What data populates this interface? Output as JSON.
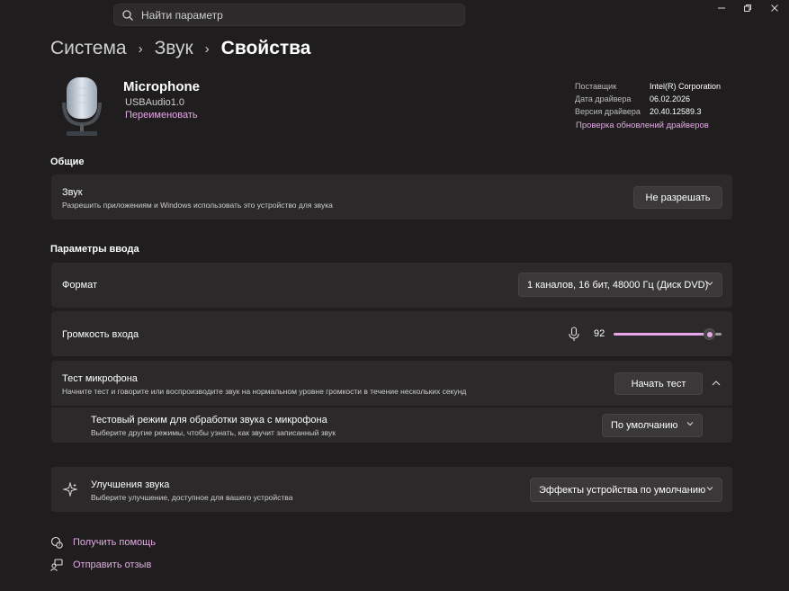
{
  "search": {
    "placeholder": "Найти параметр"
  },
  "breadcrumb": {
    "item1": "Система",
    "item2": "Звук",
    "current": "Свойства"
  },
  "device": {
    "name": "Microphone",
    "subname": "USBAudio1.0",
    "rename": "Переименовать",
    "info": [
      {
        "key": "Поставщик",
        "value": "Intel(R) Corporation"
      },
      {
        "key": "Дата драйвера",
        "value": "06.02.2026"
      },
      {
        "key": "Версия драйвера",
        "value": "20.40.12589.3"
      }
    ],
    "update_link": "Проверка обновлений драйверов"
  },
  "general": {
    "title": "Общие",
    "sound_title": "Звук",
    "sound_desc": "Разрешить приложениям и Windows использовать это устройство для звука",
    "deny_button": "Не разрешать"
  },
  "input": {
    "title": "Параметры ввода",
    "format_label": "Формат",
    "format_value": "1 каналов, 16 бит, 48000 Гц (Диск DVD)",
    "volume_label": "Громкость входа",
    "volume_value": "92",
    "volume_level": 0.92,
    "test_title": "Тест микрофона",
    "test_desc": "Начните тест и говорите или воспроизводите звук на нормальном уровне громкости в течение нескольких секунд",
    "test_button": "Начать тест",
    "mode_title": "Тестовый режим для обработки звука с микрофона",
    "mode_desc": "Выберите другие режимы, чтобы узнать, как звучит записанный звук",
    "mode_value": "По умолчанию"
  },
  "enhance": {
    "title": "Улучшения звука",
    "desc": "Выберите улучшение, доступное для вашего устройства",
    "value": "Эффекты устройства по умолчанию"
  },
  "footer": {
    "help": "Получить помощь",
    "feedback": "Отправить отзыв"
  },
  "colors": {
    "accent": "#e6a8e8",
    "background": "#1f1d1d",
    "card": "#2b2929"
  }
}
